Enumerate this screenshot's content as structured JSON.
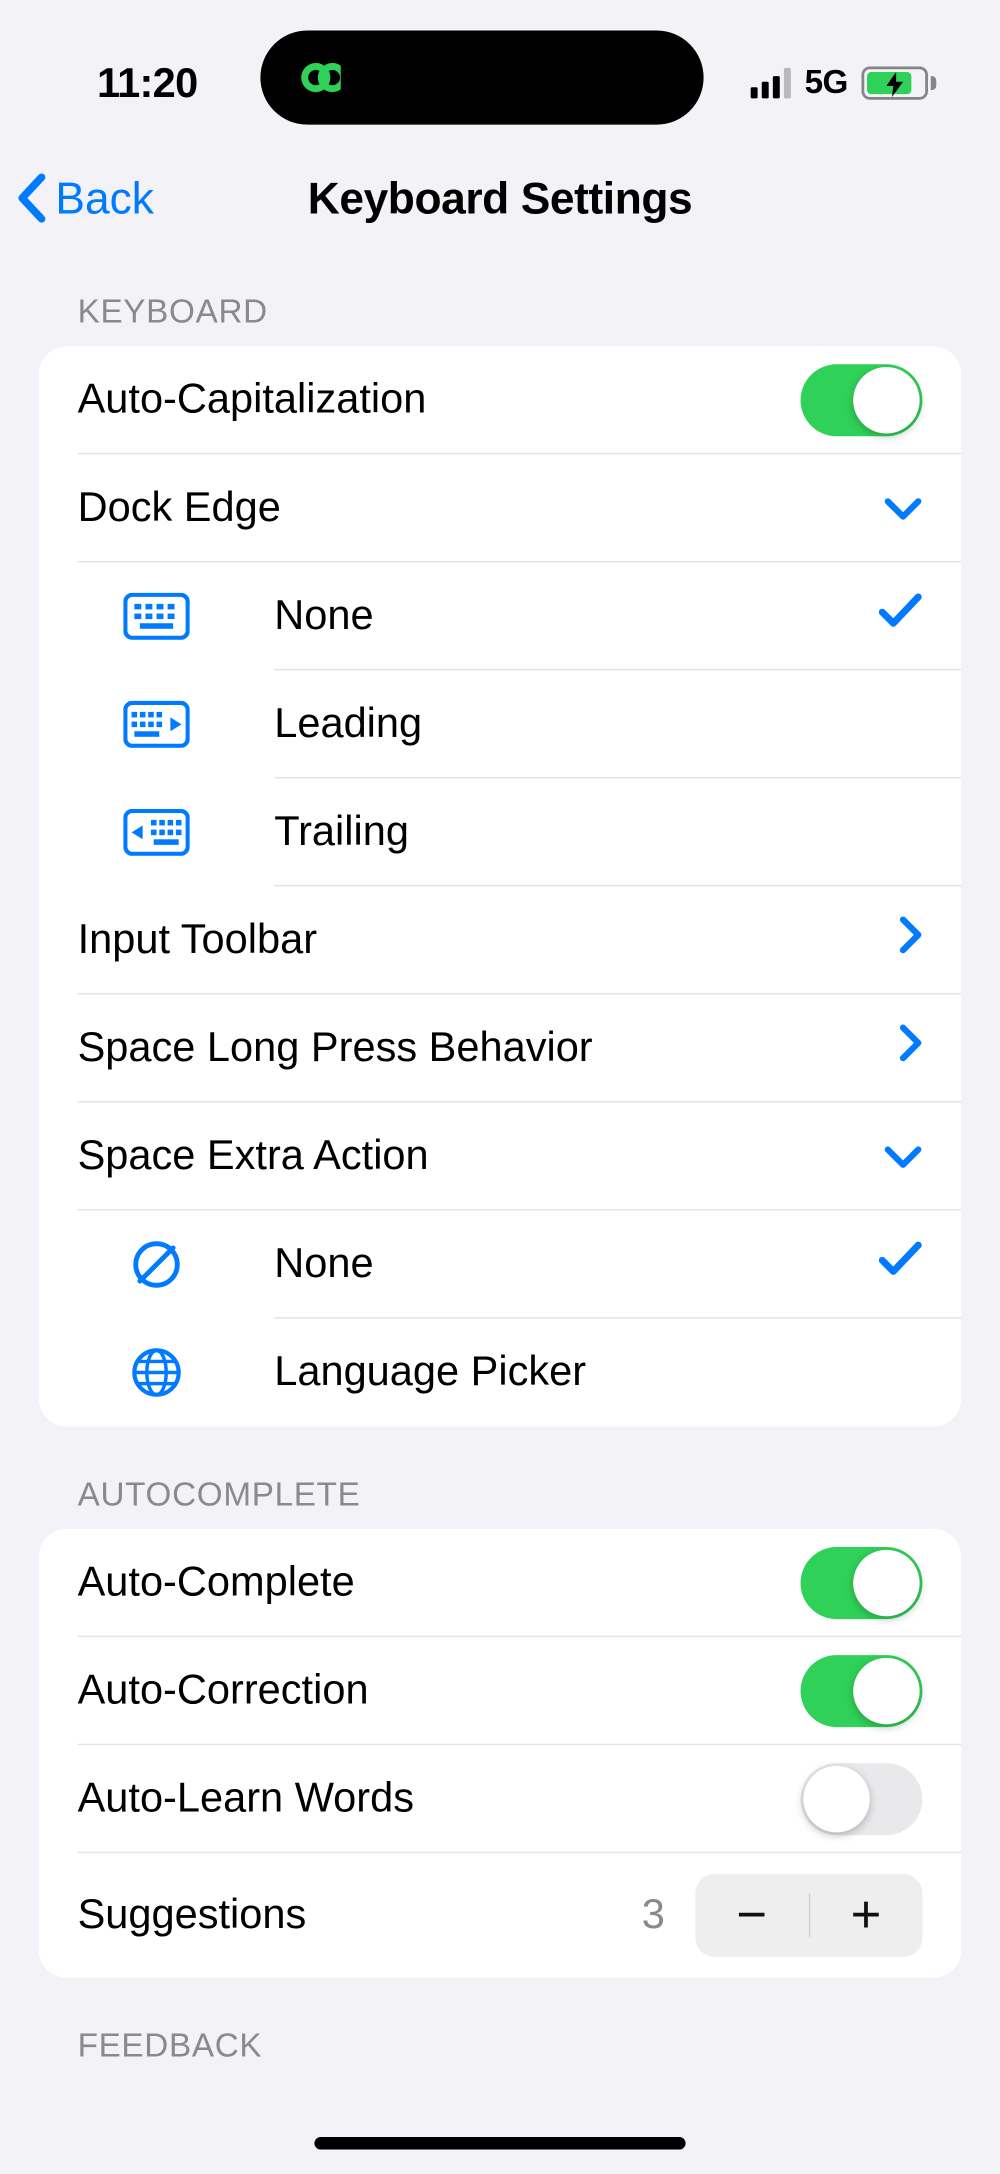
{
  "status": {
    "time": "11:20",
    "network": "5G"
  },
  "nav": {
    "back": "Back",
    "title": "Keyboard Settings"
  },
  "section1": {
    "header": "KEYBOARD"
  },
  "section2": {
    "header": "AUTOCOMPLETE"
  },
  "section3": {
    "header": "FEEDBACK"
  },
  "kb": {
    "autocap": "Auto-Capitalization",
    "dockedge": "Dock Edge",
    "de_none": "None",
    "de_leading": "Leading",
    "de_trailing": "Trailing",
    "inputtoolbar": "Input Toolbar",
    "spacelong": "Space Long Press Behavior",
    "spaceextra": "Space Extra Action",
    "se_none": "None",
    "se_lang": "Language Picker"
  },
  "ac": {
    "complete": "Auto-Complete",
    "correction": "Auto-Correction",
    "learn": "Auto-Learn Words",
    "suggestions": "Suggestions",
    "suggestions_val": "3"
  }
}
